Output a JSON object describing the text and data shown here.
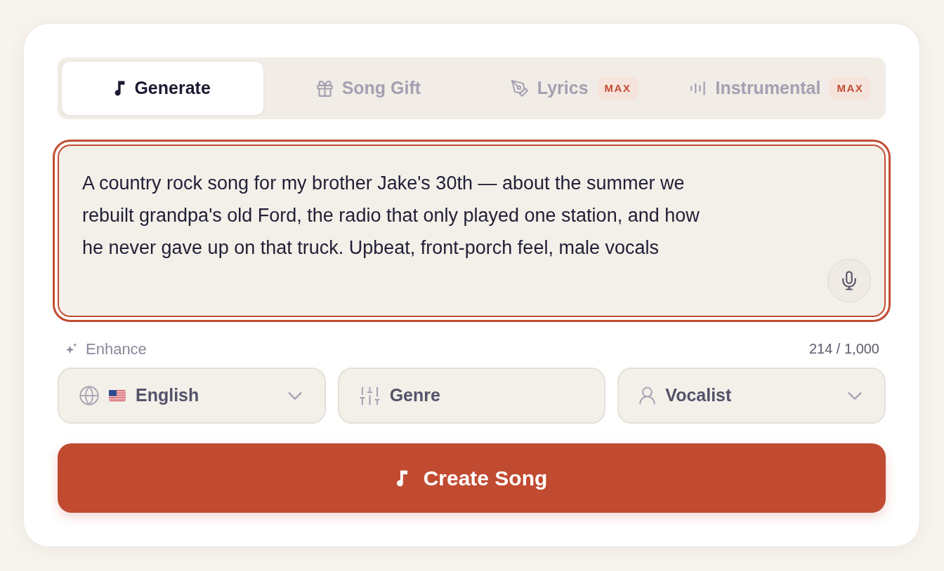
{
  "tabs": [
    {
      "label": "Generate",
      "selected": true
    },
    {
      "label": "Song Gift",
      "selected": false
    },
    {
      "label": "Lyrics",
      "selected": false,
      "badge": "MAX"
    },
    {
      "label": "Instrumental",
      "selected": false,
      "badge": "MAX"
    }
  ],
  "prompt": {
    "value": "A country rock song for my brother Jake's 30th — about the summer we rebuilt grandpa's old Ford, the radio that only played one station, and how he never gave up on that truck. Upbeat, front-porch feel, male vocals",
    "focused": true
  },
  "enhance": {
    "label": "Enhance"
  },
  "character_count": "214 / 1,000",
  "options": [
    {
      "kind": "dropdown",
      "label": "English"
    },
    {
      "kind": "picker",
      "label": "Genre"
    },
    {
      "kind": "dropdown",
      "label": "Vocalist"
    }
  ],
  "create_button": {
    "label": "Create Song"
  }
}
